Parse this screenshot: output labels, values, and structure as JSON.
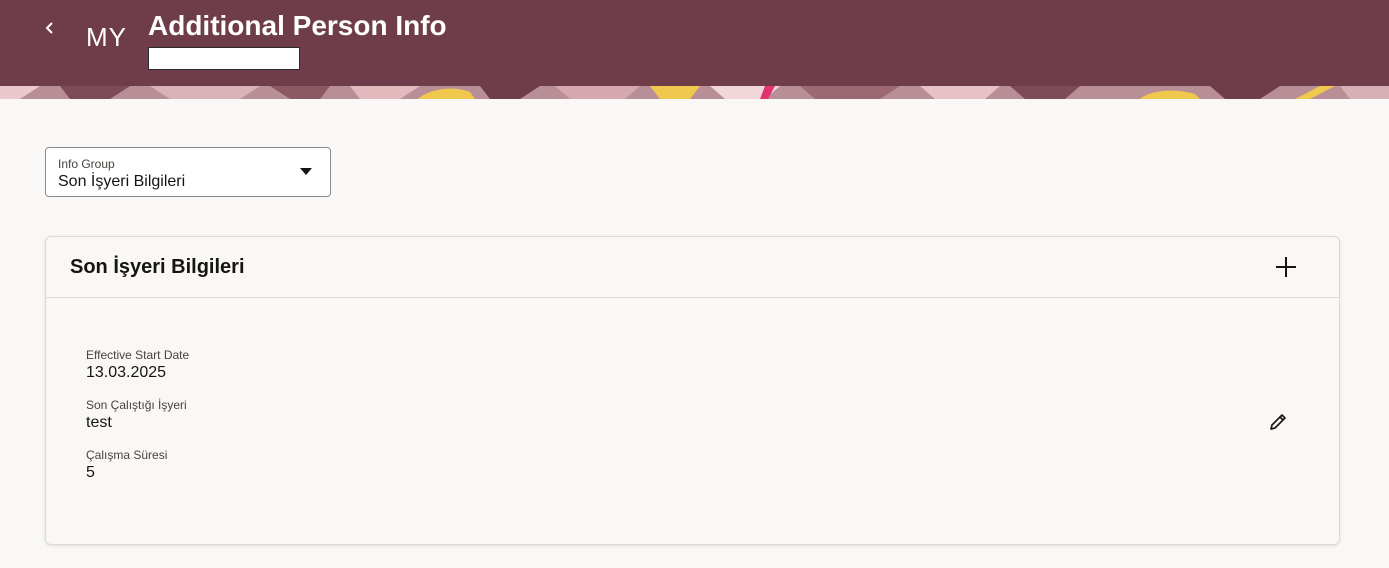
{
  "header": {
    "initials": "MY",
    "title": "Additional Person Info",
    "name_value": "",
    "background": "#6f3d4a"
  },
  "info_group": {
    "label": "Info Group",
    "value": "Son İşyeri Bilgileri"
  },
  "card": {
    "title": "Son İşyeri Bilgileri",
    "fields": [
      {
        "label": "Effective Start Date",
        "value": "13.03.2025"
      },
      {
        "label": "Son Çalıştığı İşyeri",
        "value": "test"
      },
      {
        "label": "Çalışma Süresi",
        "value": "5"
      }
    ]
  },
  "icons": {
    "back": "chevron-left-icon",
    "dropdown": "caret-down-icon",
    "add": "plus-icon",
    "edit": "pencil-icon"
  }
}
